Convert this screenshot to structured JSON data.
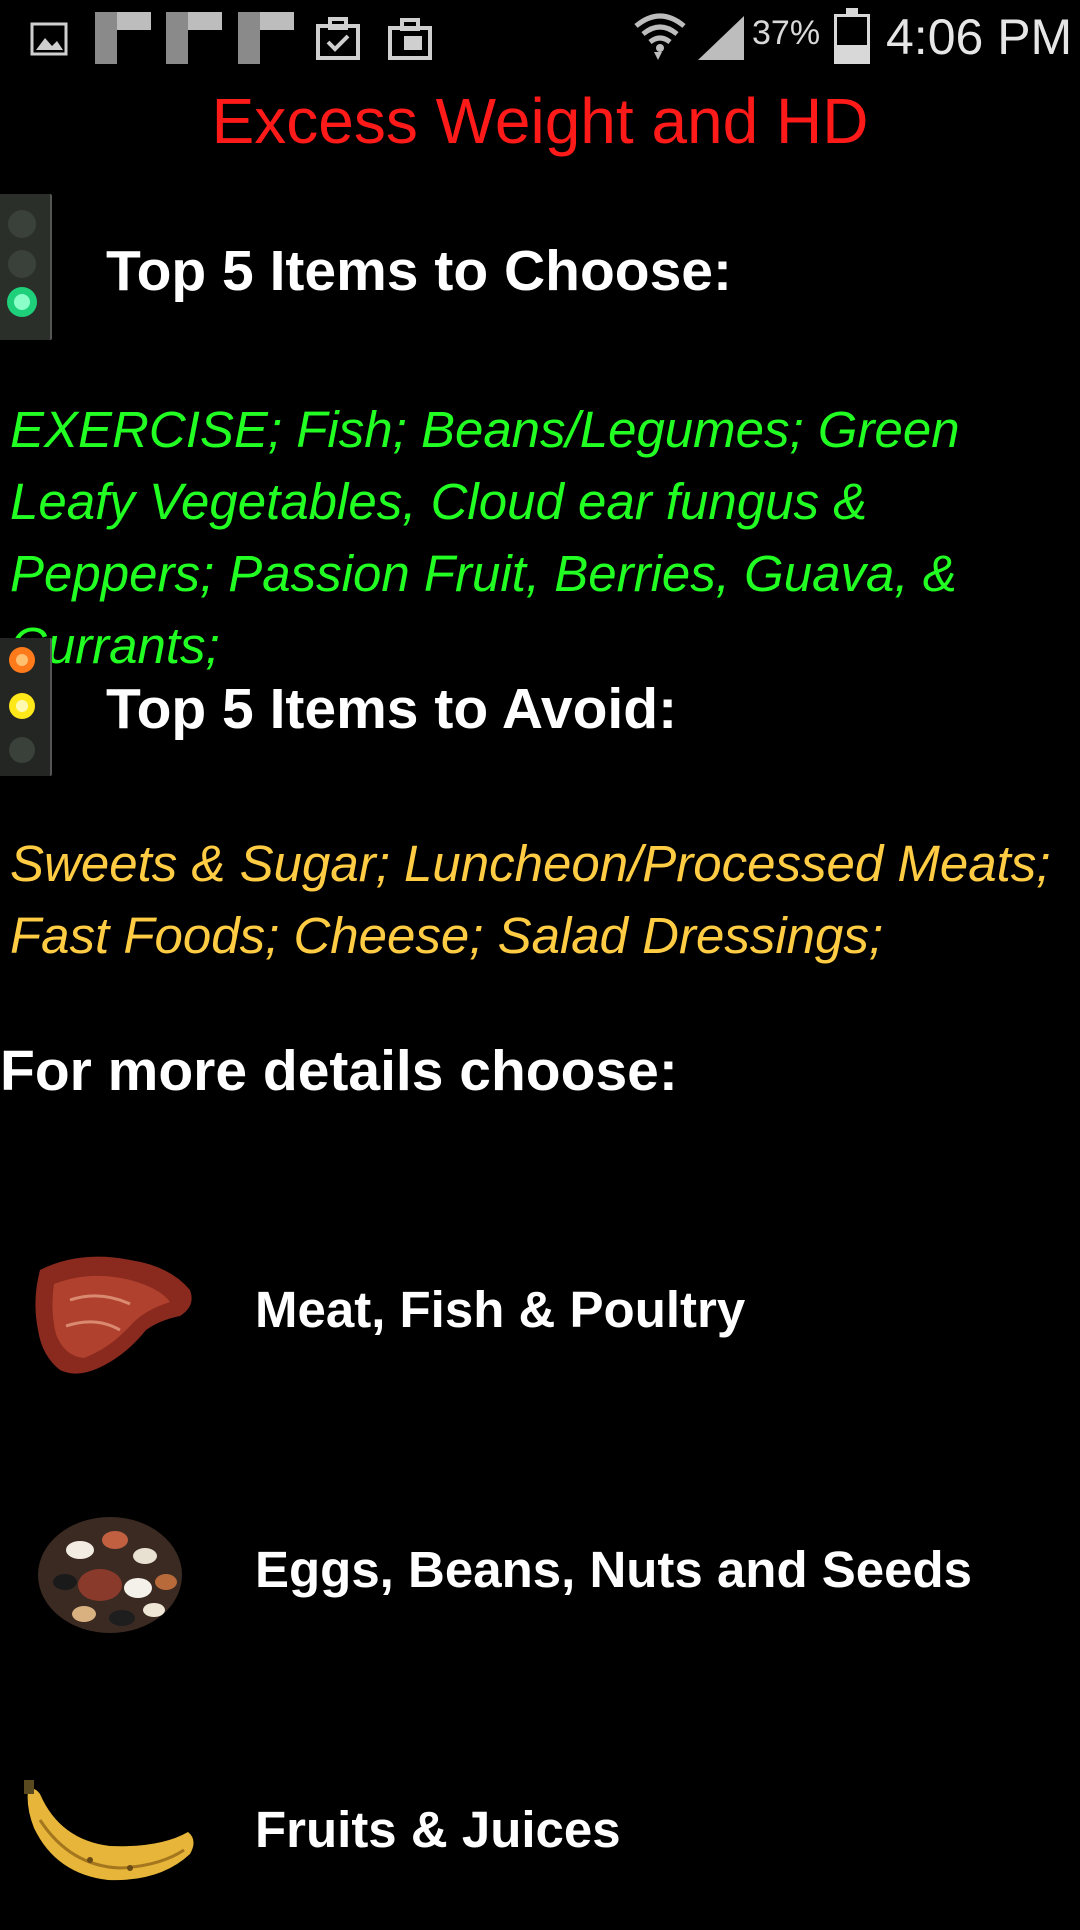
{
  "status_bar": {
    "battery_percent": "37%",
    "time": "4:06 PM",
    "icons": [
      "gallery-icon",
      "notification-tile-icon",
      "notification-tile-icon",
      "notification-tile-icon",
      "clipboard-check-icon",
      "briefcase-icon",
      "wifi-icon",
      "signal-icon",
      "battery-icon"
    ]
  },
  "header": {
    "title": "Excess Weight and HD"
  },
  "choose_section": {
    "heading": "Top 5 Items to Choose:",
    "items": "EXERCISE; Fish; Beans/Legumes; Green Leafy Vegetables, Cloud ear fungus & Peppers; Passion Fruit, Berries, Guava, & Currants;",
    "color": "#22ff22",
    "icon": "green-traffic-light-icon"
  },
  "avoid_section": {
    "heading": "Top 5 Items to Avoid:",
    "items": "Sweets & Sugar; Luncheon/Processed Meats; Fast Foods; Cheese; Salad Dressings;",
    "color": "#ffcc44",
    "icon": "yellow-traffic-light-icon"
  },
  "details": {
    "heading": "For more details choose:",
    "categories": [
      {
        "label": "Meat, Fish & Poultry",
        "icon": "steak-icon"
      },
      {
        "label": "Eggs, Beans, Nuts and Seeds",
        "icon": "beans-icon"
      },
      {
        "label": "Fruits & Juices",
        "icon": "banana-icon"
      }
    ]
  },
  "colors": {
    "title": "#ff1a1a",
    "background": "#000000"
  }
}
